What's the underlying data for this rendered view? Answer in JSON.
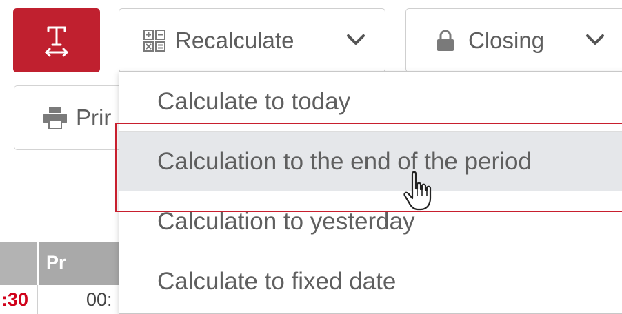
{
  "toolbar": {
    "text_button_icon": "text-resize-icon",
    "recalculate": {
      "label": "Recalculate",
      "icon": "calculator-grid-icon"
    },
    "closing": {
      "label": "Closing",
      "icon": "lock-icon"
    },
    "print": {
      "label": "Prir",
      "icon": "printer-icon"
    }
  },
  "dropdown": {
    "items": [
      {
        "label": "Calculate to today"
      },
      {
        "label": "Calculation to the end of the period",
        "hovered": true
      },
      {
        "label": "Calculation to yesterday"
      },
      {
        "label": "Calculate to fixed date"
      }
    ]
  },
  "table": {
    "header": {
      "label": "Pr"
    },
    "row": {
      "cell_red": ":30",
      "cell_time": "00:"
    }
  },
  "colors": {
    "brand_red": "#c0202f",
    "hover_bg": "#e5e7ea",
    "highlight_border": "#c81f2e",
    "table_header": "#a9a9a9"
  }
}
